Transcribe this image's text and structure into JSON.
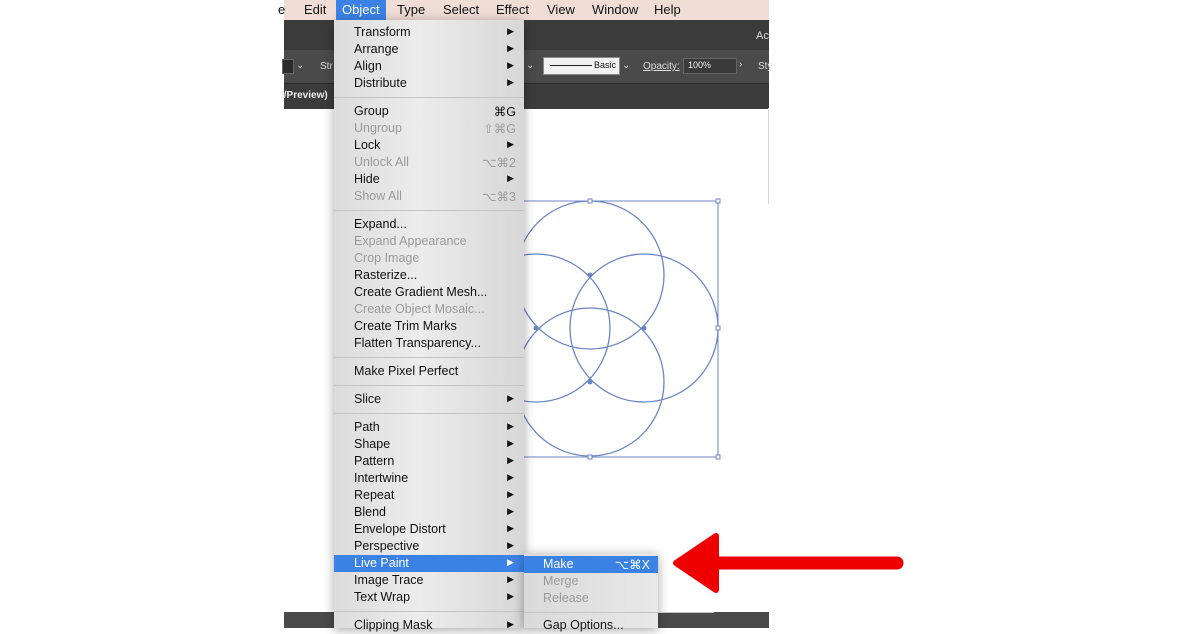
{
  "menubar": {
    "items": [
      {
        "label": "e"
      },
      {
        "label": "Edit"
      },
      {
        "label": "Object",
        "active": true
      },
      {
        "label": "Type"
      },
      {
        "label": "Select"
      },
      {
        "label": "Effect"
      },
      {
        "label": "View"
      },
      {
        "label": "Window"
      },
      {
        "label": "Help"
      }
    ]
  },
  "appbar": {
    "title_fragment": "Ac",
    "stroke_label": "Str",
    "brush_style": "Basic",
    "opacity_label": "Opacity:",
    "opacity_value": "100%",
    "style_fragment": "Sty",
    "tab_fragment": "l/Preview)"
  },
  "object_menu": {
    "items": [
      {
        "label": "Transform",
        "submenu": true
      },
      {
        "label": "Arrange",
        "submenu": true
      },
      {
        "label": "Align",
        "submenu": true
      },
      {
        "label": "Distribute",
        "submenu": true
      },
      {
        "label": "Group",
        "shortcut": "⌘G"
      },
      {
        "label": "Ungroup",
        "shortcut": "⇧⌘G",
        "disabled": true
      },
      {
        "label": "Lock",
        "submenu": true
      },
      {
        "label": "Unlock All",
        "shortcut": "⌥⌘2",
        "disabled": true
      },
      {
        "label": "Hide",
        "submenu": true
      },
      {
        "label": "Show All",
        "shortcut": "⌥⌘3",
        "disabled": true
      },
      {
        "label": "Expand..."
      },
      {
        "label": "Expand Appearance",
        "disabled": true
      },
      {
        "label": "Crop Image",
        "disabled": true
      },
      {
        "label": "Rasterize..."
      },
      {
        "label": "Create Gradient Mesh..."
      },
      {
        "label": "Create Object Mosaic...",
        "disabled": true
      },
      {
        "label": "Create Trim Marks"
      },
      {
        "label": "Flatten Transparency..."
      },
      {
        "label": "Make Pixel Perfect"
      },
      {
        "label": "Slice",
        "submenu": true
      },
      {
        "label": "Path",
        "submenu": true
      },
      {
        "label": "Shape",
        "submenu": true
      },
      {
        "label": "Pattern",
        "submenu": true
      },
      {
        "label": "Intertwine",
        "submenu": true
      },
      {
        "label": "Repeat",
        "submenu": true
      },
      {
        "label": "Blend",
        "submenu": true
      },
      {
        "label": "Envelope Distort",
        "submenu": true
      },
      {
        "label": "Perspective",
        "submenu": true
      },
      {
        "label": "Live Paint",
        "submenu": true,
        "highlighted": true
      },
      {
        "label": "Image Trace",
        "submenu": true
      },
      {
        "label": "Text Wrap",
        "submenu": true
      },
      {
        "label": "Clipping Mask",
        "submenu": true
      }
    ]
  },
  "live_paint_submenu": {
    "items": [
      {
        "label": "Make",
        "shortcut": "⌥⌘X",
        "highlighted": true
      },
      {
        "label": "Merge",
        "disabled": true
      },
      {
        "label": "Release",
        "disabled": true
      },
      {
        "label": "Gap Options..."
      }
    ]
  },
  "submenu_arrow_glyph": "▶",
  "colors": {
    "menu_highlight": "#3b82e6",
    "artwork_stroke": "#6b86c4",
    "annotation_arrow": "#ee0000"
  }
}
